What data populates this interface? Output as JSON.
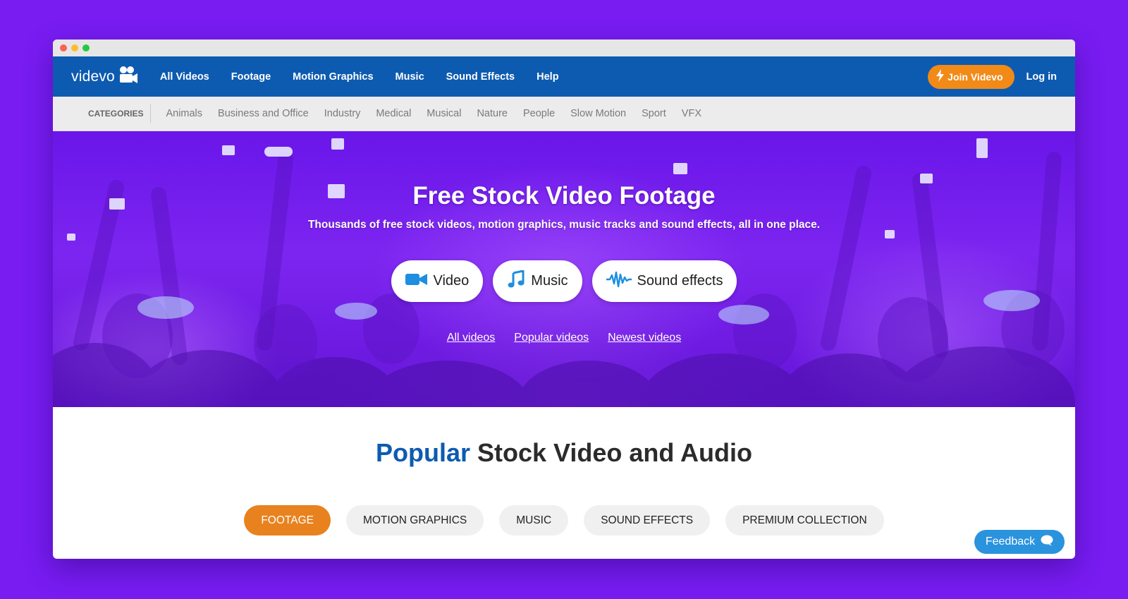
{
  "brand": {
    "logo_text": "videvo",
    "accent": "#0d5bb0",
    "highlight": "#f28a18"
  },
  "nav": {
    "links": [
      "All Videos",
      "Footage",
      "Motion Graphics",
      "Music",
      "Sound Effects",
      "Help"
    ],
    "join_label": "Join Videvo",
    "login_label": "Log in"
  },
  "categories": {
    "label": "CATEGORIES",
    "items": [
      "Animals",
      "Business and Office",
      "Industry",
      "Medical",
      "Musical",
      "Nature",
      "People",
      "Slow Motion",
      "Sport",
      "VFX"
    ]
  },
  "hero": {
    "title": "Free Stock Video Footage",
    "subtitle": "Thousands of free stock videos, motion graphics, music tracks and sound effects, all in one place.",
    "buttons": [
      {
        "label": "Video",
        "icon": "video-camera-icon"
      },
      {
        "label": "Music",
        "icon": "music-note-icon"
      },
      {
        "label": "Sound effects",
        "icon": "waveform-icon"
      }
    ],
    "links": [
      "All videos",
      "Popular videos",
      "Newest videos"
    ]
  },
  "popular": {
    "title_accent": "Popular",
    "title_rest": " Stock Video and Audio",
    "tabs": [
      "FOOTAGE",
      "MOTION GRAPHICS",
      "MUSIC",
      "SOUND EFFECTS",
      "PREMIUM COLLECTION"
    ],
    "active_tab": "FOOTAGE"
  },
  "feedback": {
    "label": "Feedback"
  }
}
